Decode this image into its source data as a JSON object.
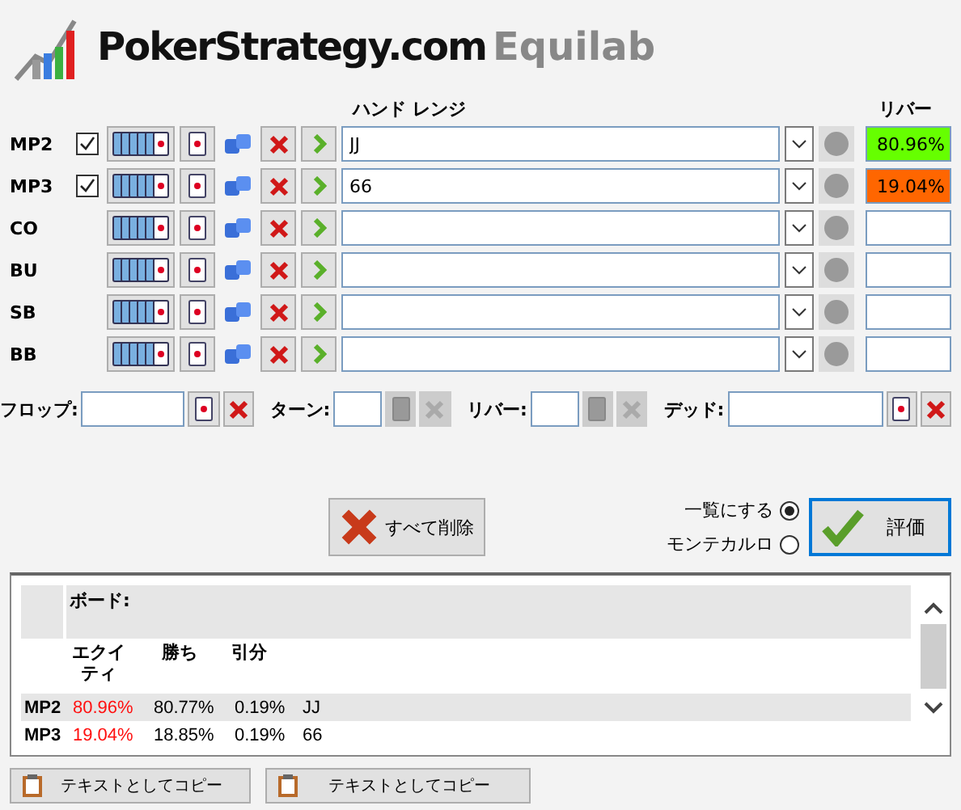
{
  "logo": {
    "brand": "PokerStrategy.com",
    "product": "Equilab"
  },
  "range_header": "ハンド レンジ",
  "equity_header": "リバー",
  "players": [
    {
      "name": "MP2",
      "checked": true,
      "range": "JJ",
      "equity": "80.96%",
      "color": "#66ff00"
    },
    {
      "name": "MP3",
      "checked": true,
      "range": "66",
      "equity": "19.04%",
      "color": "#ff6600"
    },
    {
      "name": "CO"
    },
    {
      "name": "BU"
    },
    {
      "name": "SB"
    },
    {
      "name": "BB"
    }
  ],
  "board": [
    {
      "label": "フロップ:",
      "kind": "flop",
      "disabled": false
    },
    {
      "label": "ターン:",
      "kind": "turn",
      "disabled": true
    },
    {
      "label": "リバー:",
      "kind": "river",
      "disabled": true
    },
    {
      "label": "デッド:",
      "kind": "dead",
      "disabled": false
    }
  ],
  "clear_all": "すべて削除",
  "modes": [
    {
      "label": "一覧にする",
      "selected": true
    },
    {
      "label": "モンテカルロ",
      "selected": false
    }
  ],
  "evaluate": "評価",
  "results": {
    "board_label": "ボード:",
    "columns": [
      "エクイティ",
      "勝ち",
      "引分"
    ],
    "rows": [
      {
        "player": "MP2",
        "equity": "80.96%",
        "win": "80.77%",
        "tie": "0.19%",
        "hand": "JJ"
      },
      {
        "player": "MP3",
        "equity": "19.04%",
        "win": "18.85%",
        "tie": "0.19%",
        "hand": "66"
      }
    ]
  },
  "copy_buttons": [
    "テキストとしてコピー",
    "テキストとしてコピー"
  ]
}
